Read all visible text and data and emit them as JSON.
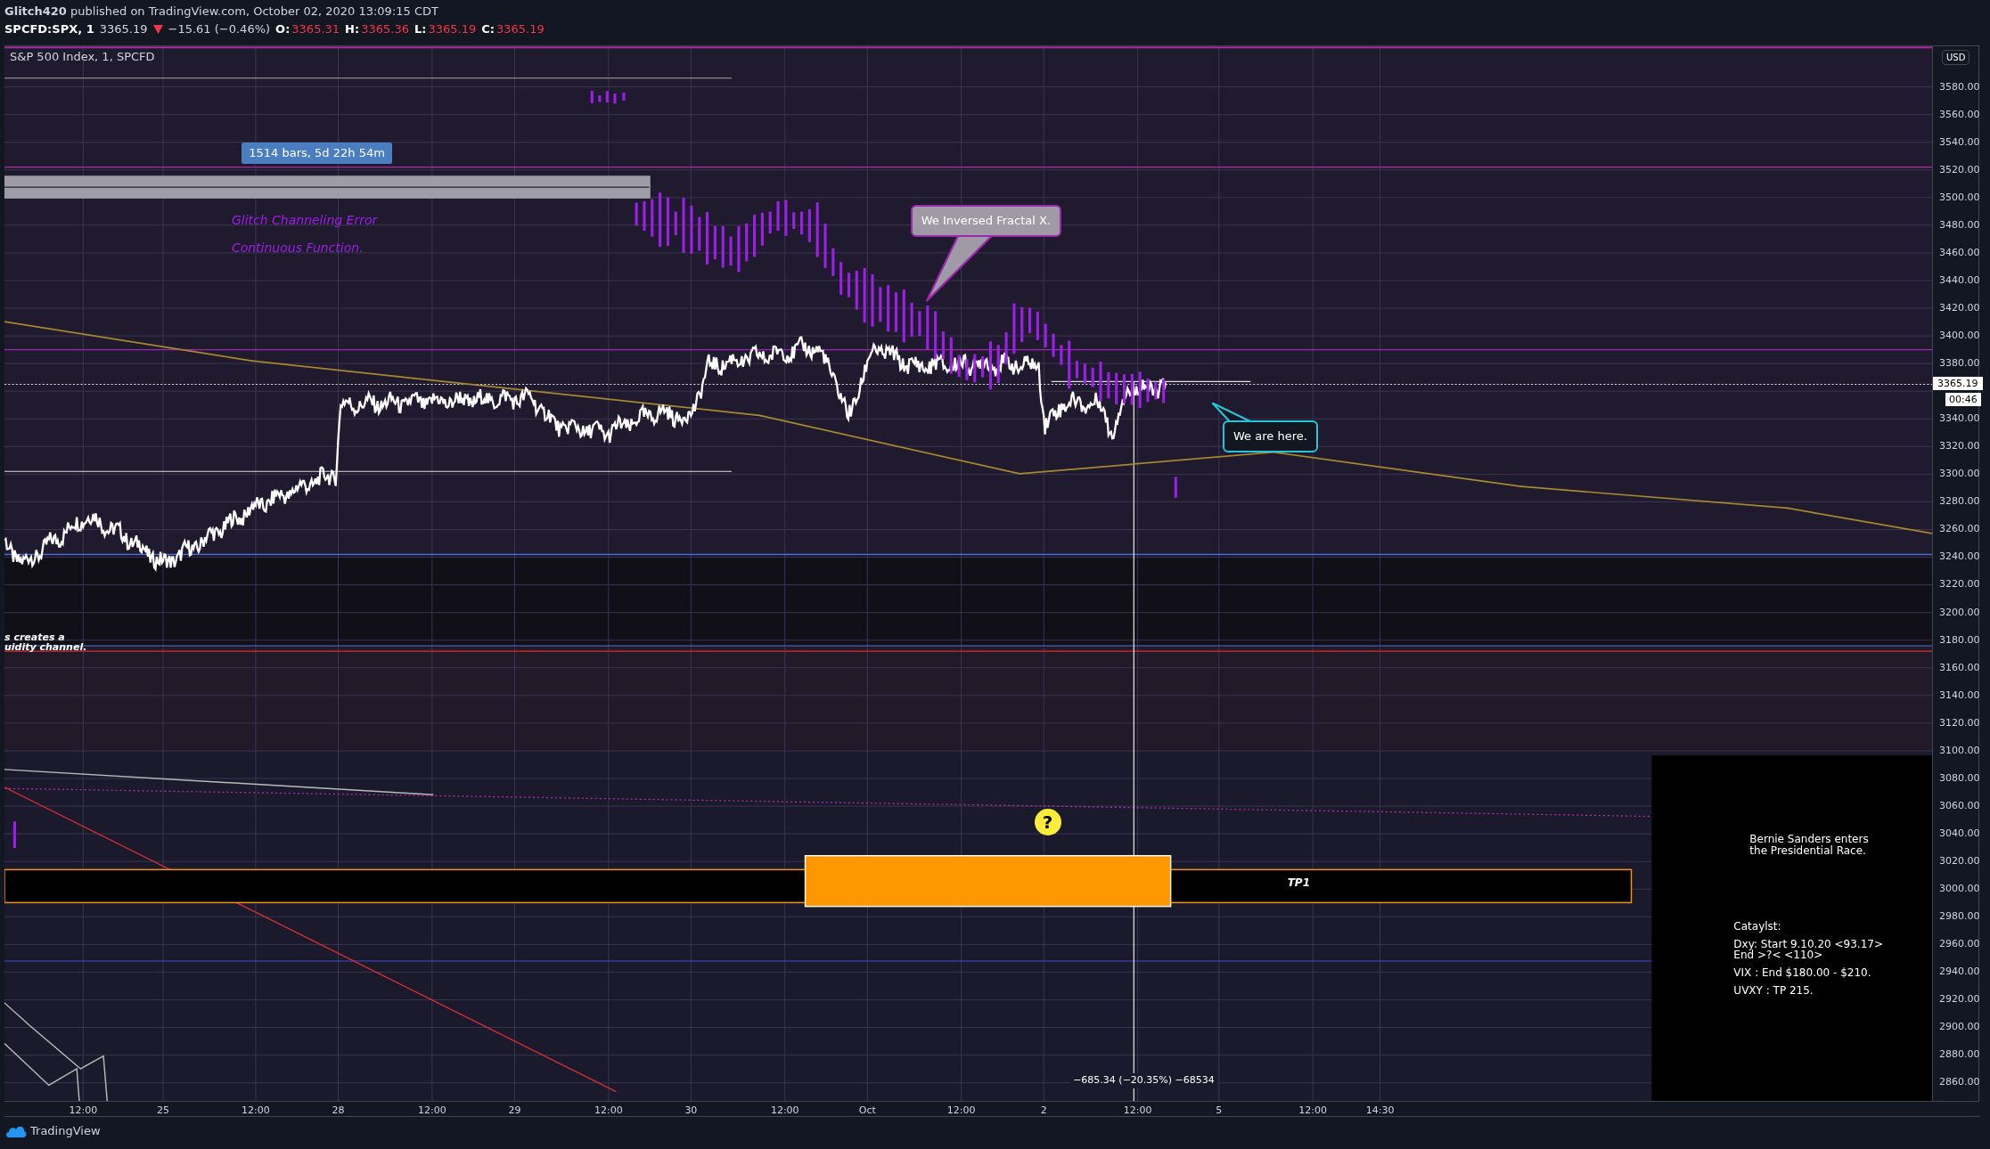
{
  "header": {
    "publish_line": "**Glitch420** published on TradingView.com, October 02, 2020 13:09:15 CDT",
    "symbol": "SPCFD:SPX, 1",
    "last": "3365.19",
    "price_down": true,
    "change": "−15.61 (−0.46%)",
    "ohlc": [
      {
        "label": "O:",
        "value": "3365.31"
      },
      {
        "label": "H:",
        "value": "3365.36"
      },
      {
        "label": "L:",
        "value": "3365.19"
      },
      {
        "label": "C:",
        "value": "3365.19"
      }
    ]
  },
  "legend": "S&P 500 Index, 1, SPCFD",
  "annotations": [
    {
      "kind": "badge",
      "text": "1514 bars, 5d 22h 54m"
    },
    {
      "kind": "purple",
      "text": "Glitch Channeling Error"
    },
    {
      "kind": "purple",
      "text": "Continuous Function."
    },
    {
      "kind": "callout",
      "text": "We Inversed Fractal X.",
      "color": "#9c27b0"
    },
    {
      "kind": "callout",
      "text": "We are here.",
      "color": "#26c6da"
    },
    {
      "kind": "cut",
      "text": "s creates a"
    },
    {
      "kind": "cut",
      "text": "uidity channel."
    },
    {
      "kind": "tp",
      "text": "TP1"
    },
    {
      "kind": "question",
      "text": "?"
    },
    {
      "kind": "measure",
      "text": "−685.34 (−20.35%) −68534"
    }
  ],
  "note_box": {
    "headline": "Bernie Sanders enters the Presidential Race.",
    "lines": [
      "Cataylst:",
      "Dxy: Start 9.10.20 <93.17>\nEnd >?< <110>",
      "VIX : End $180.00 - $210.",
      "UVXY : TP 215."
    ]
  },
  "price_axis": {
    "currency": "USD",
    "upper": [
      "3580.00",
      "3560.00",
      "3540.00",
      "3520.00",
      "3500.00",
      "3480.00",
      "3460.00",
      "3440.00",
      "3420.00",
      "3400.00",
      "3380.00"
    ],
    "lower": [
      "3340.00",
      "3320.00",
      "3300.00",
      "3280.00",
      "3260.00",
      "3240.00",
      "3220.00",
      "3200.00",
      "3180.00",
      "3160.00",
      "3140.00",
      "3120.00",
      "3100.00",
      "3080.00",
      "3060.00",
      "3040.00",
      "3020.00",
      "3000.00",
      "2980.00",
      "2960.00",
      "2940.00",
      "2920.00",
      "2900.00",
      "2880.00",
      "2860.00"
    ],
    "last_price": "3365.19",
    "countdown": "00:46"
  },
  "time_axis": [
    "12:00",
    "25",
    "12:00",
    "28",
    "12:00",
    "29",
    "12:00",
    "30",
    "12:00",
    "Oct",
    "12:00",
    "2",
    "12:00",
    "5",
    "12:00",
    "14:30"
  ],
  "footer": {
    "brand": "TradingView"
  }
}
